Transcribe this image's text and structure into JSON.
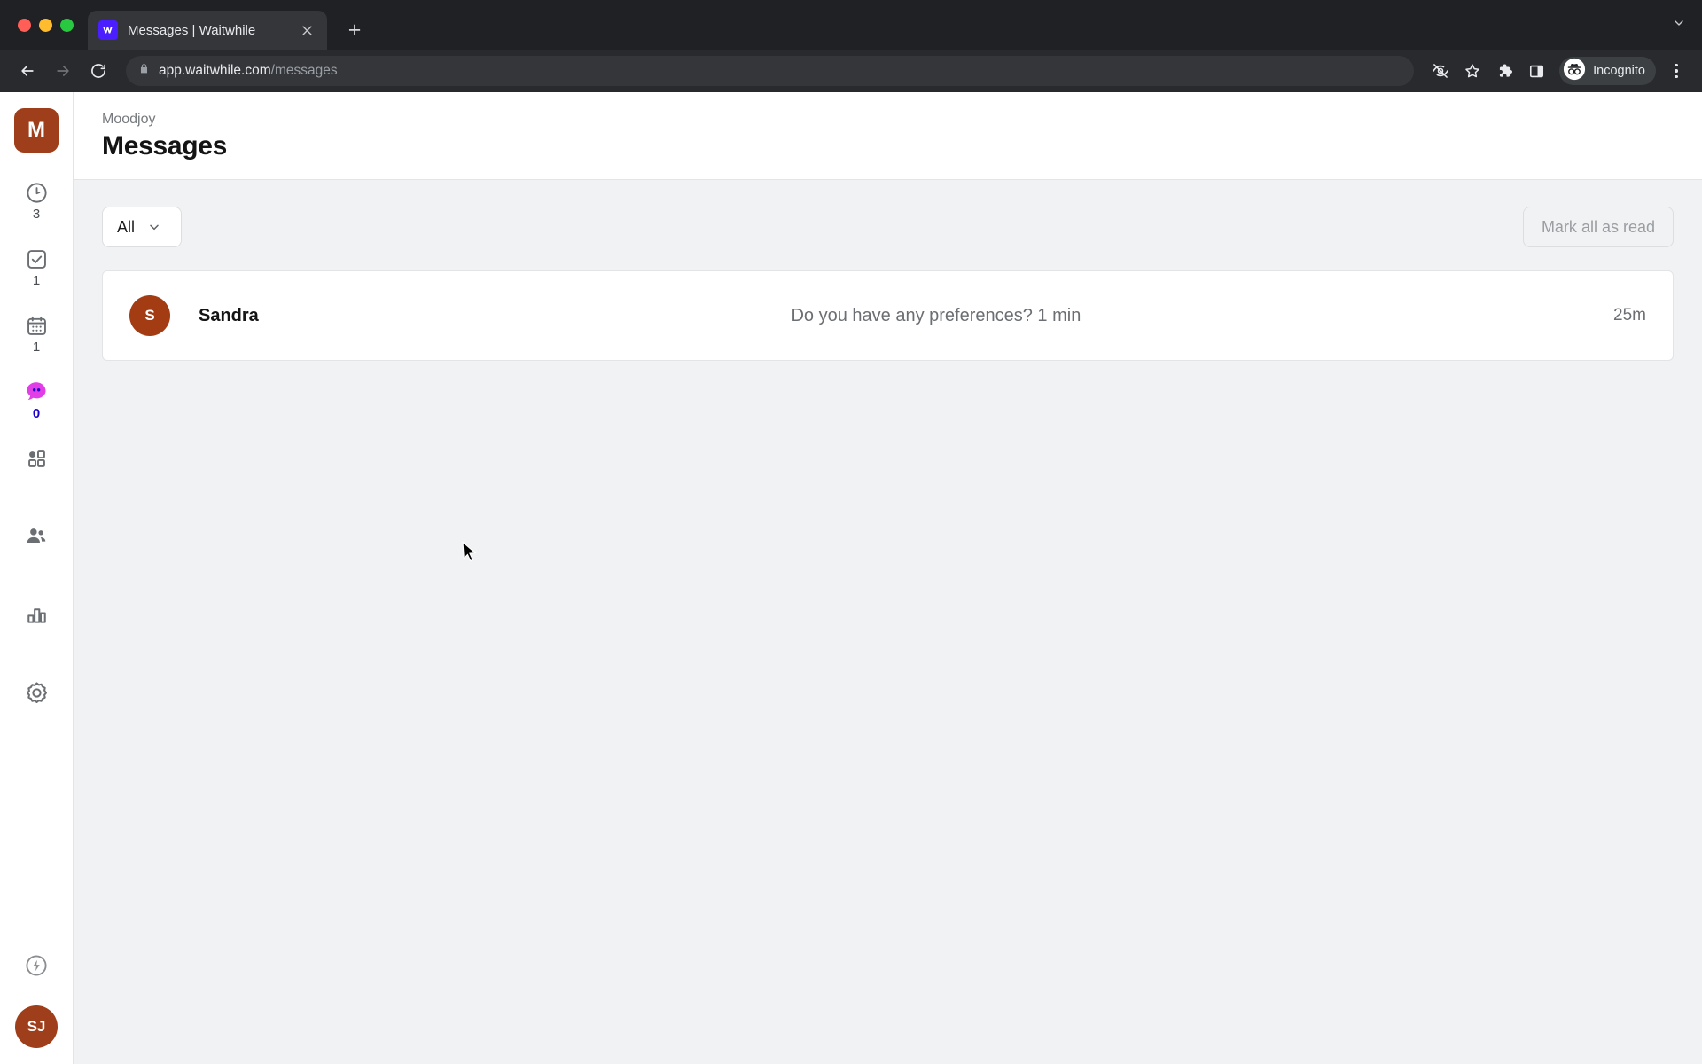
{
  "browser": {
    "tab": {
      "title": "Messages | Waitwhile",
      "favicon_icon": "waitwhile-logo-icon",
      "close_icon": "close-icon"
    },
    "new_tab_label": "+",
    "tab_list_icon": "chevron-down-icon",
    "nav": {
      "back_icon": "back-arrow-icon",
      "forward_icon": "forward-arrow-icon",
      "reload_icon": "reload-icon"
    },
    "omnibox": {
      "lock_icon": "lock-icon",
      "url_host": "app.waitwhile.com",
      "url_path": "/messages"
    },
    "toolbar_icons": [
      {
        "name": "tracking-protection-icon",
        "label": ""
      },
      {
        "name": "bookmark-star-icon",
        "label": ""
      },
      {
        "name": "extensions-puzzle-icon",
        "label": ""
      },
      {
        "name": "side-panel-icon",
        "label": ""
      }
    ],
    "incognito": {
      "label": "Incognito",
      "icon": "incognito-avatar-icon"
    },
    "menu_icon": "kebab-menu-icon"
  },
  "sidebar": {
    "org_logo": {
      "label": "M",
      "color": "#9e3e1a"
    },
    "items": [
      {
        "name": "waitlist",
        "icon": "clock-icon",
        "count": "3",
        "active": false
      },
      {
        "name": "checked-in",
        "icon": "check-square-icon",
        "count": "1",
        "active": false
      },
      {
        "name": "bookings",
        "icon": "calendar-icon",
        "count": "1",
        "active": false
      },
      {
        "name": "messages",
        "icon": "chat-bubble-icon",
        "count": "0",
        "active": true
      },
      {
        "name": "apps",
        "icon": "grid-apps-icon",
        "count": "",
        "active": false
      },
      {
        "name": "customers",
        "icon": "people-icon",
        "count": "",
        "active": false
      },
      {
        "name": "analytics",
        "icon": "bar-chart-icon",
        "count": "",
        "active": false
      },
      {
        "name": "settings",
        "icon": "gear-icon",
        "count": "",
        "active": false
      }
    ],
    "bolt": {
      "icon": "lightning-bolt-icon"
    },
    "user_avatar": {
      "initials": "SJ",
      "color": "#9e3e1a"
    }
  },
  "header": {
    "breadcrumb": "Moodjoy",
    "title": "Messages"
  },
  "toolbar": {
    "filter": {
      "value": "All",
      "chevron_icon": "chevron-down-icon"
    },
    "mark_all_read_label": "Mark all as read"
  },
  "messages": [
    {
      "avatar_initial": "S",
      "avatar_color": "#a43c13",
      "name": "Sandra",
      "preview": "Do you have any preferences? 1 min",
      "time": "25m"
    }
  ],
  "colors": {
    "accent_brown": "#9e3e1a",
    "active_magenta": "#e040e0",
    "active_count_blue": "#1b00c8",
    "page_bg": "#f1f2f3"
  }
}
